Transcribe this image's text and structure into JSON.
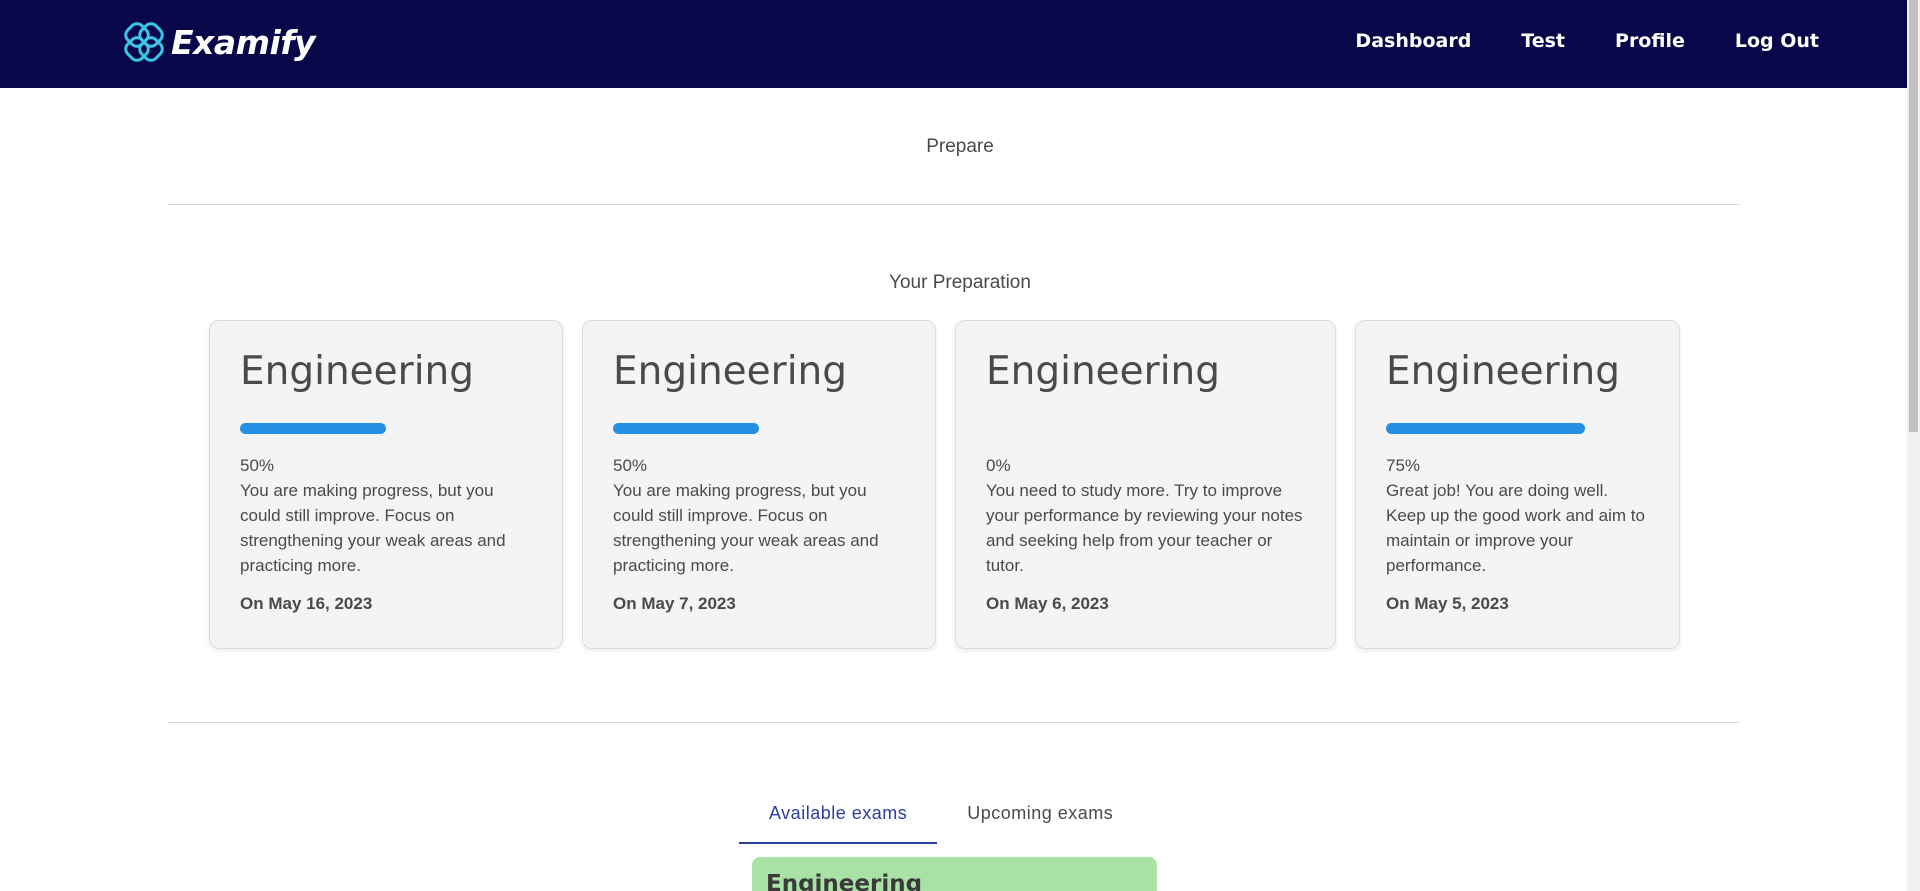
{
  "nav": {
    "brand": "Examify",
    "links": [
      "Dashboard",
      "Test",
      "Profile",
      "Log Out"
    ]
  },
  "sections": {
    "prepare": "Prepare",
    "your_preparation": "Your Preparation"
  },
  "cards": [
    {
      "title": "Engineering",
      "progress": 0.5,
      "percent": "50%",
      "message": "You are making progress, but you could still improve. Focus on strengthening your weak areas and practicing more.",
      "date": "On May 16, 2023"
    },
    {
      "title": "Engineering",
      "progress": 0.5,
      "percent": "50%",
      "message": "You are making progress, but you could still improve. Focus on strengthening your weak areas and practicing more.",
      "date": "On May 7, 2023"
    },
    {
      "title": "Engineering",
      "progress": 0,
      "percent": "0%",
      "message": "You need to study more. Try to improve your performance by reviewing your notes and seeking help from your teacher or tutor.",
      "date": "On May 6, 2023"
    },
    {
      "title": "Engineering",
      "progress": 0.75,
      "percent": "75%",
      "message": "Great job! You are doing well. Keep up the good work and aim to maintain or improve your performance.",
      "date": "On May 5, 2023"
    }
  ],
  "tabs": {
    "available": "Available exams",
    "upcoming": "Upcoming exams"
  },
  "exam_list": [
    {
      "title": "Engineering"
    }
  ],
  "colors": {
    "navbar": "#07074a",
    "progress": "#2390e6",
    "tab_active": "#2a3ea0",
    "exam_card": "#a8e2a4"
  }
}
